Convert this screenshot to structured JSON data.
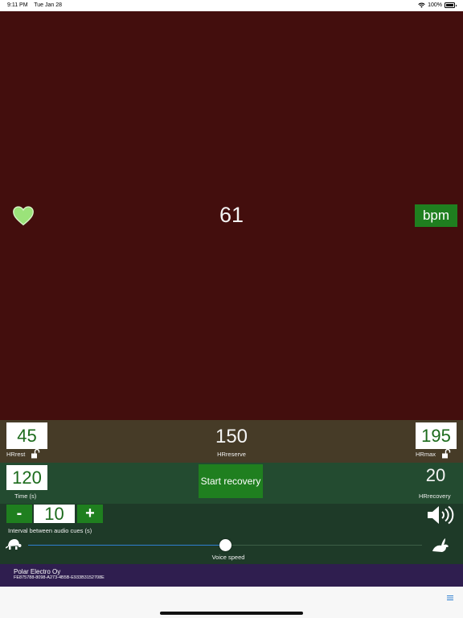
{
  "status_bar": {
    "time": "9:11 PM",
    "date": "Tue Jan 28",
    "battery": "100%"
  },
  "hr": {
    "value": "61",
    "unit_button": "bpm"
  },
  "zones": {
    "hrrest": {
      "value": "45",
      "label": "HRrest"
    },
    "hrreserve": {
      "value": "150",
      "label": "HRreserve"
    },
    "hrmax": {
      "value": "195",
      "label": "HRmax"
    }
  },
  "recovery": {
    "time": {
      "value": "120",
      "label": "Time (s)"
    },
    "start_label": "Start recovery",
    "hrrecovery": {
      "value": "20",
      "label": "HRrecovery"
    }
  },
  "audio_cues": {
    "minus": "-",
    "interval": "10",
    "plus": "+",
    "label": "Interval between audio cues (s)",
    "voice_speed_label": "Voice speed",
    "voice_speed_fraction": 0.5
  },
  "device": {
    "name": "Polar Electro Oy",
    "id": "FE875788-8098-A273-4B5B-E933B3152708E"
  },
  "colors": {
    "hr_background": "#430e0d",
    "accent_green": "#1f7f1f",
    "heart": "#9be37a",
    "slider_fill": "#2f7fd0"
  },
  "icons": [
    "heart-icon",
    "lock-icon",
    "speaker-icon",
    "turtle-icon",
    "rabbit-icon",
    "menu-icon",
    "wifi-icon",
    "battery-icon"
  ]
}
